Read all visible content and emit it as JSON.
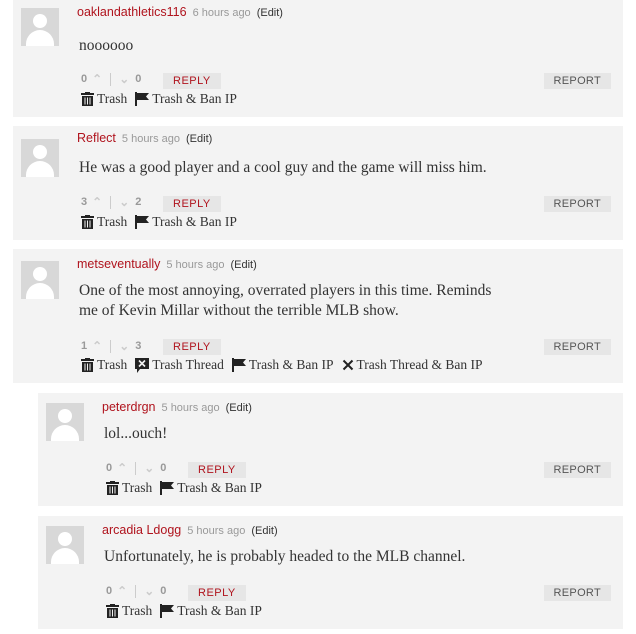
{
  "labels": {
    "edit": "(Edit)",
    "reply": "REPLY",
    "report": "REPORT",
    "trash": "Trash",
    "trash_thread": "Trash Thread",
    "trash_ban_ip": "Trash & Ban IP",
    "trash_thread_ban_ip": "Trash Thread & Ban IP"
  },
  "comments": [
    {
      "author": "oaklandathletics116",
      "time": "6 hours ago",
      "text": "noooooo",
      "up": "0",
      "down": "0"
    },
    {
      "author": "Reflect",
      "time": "5 hours ago",
      "text": "He was a good player and a cool guy and the game will miss him.",
      "up": "3",
      "down": "2"
    },
    {
      "author": "metseventually",
      "time": "5 hours ago",
      "text_line1": "One of the most annoying, overrated players in this time. Reminds",
      "text_line2": "me of Kevin Millar without the terrible MLB show.",
      "up": "1",
      "down": "3"
    },
    {
      "author": "peterdrgn",
      "time": "5 hours ago",
      "text": "lol...ouch!",
      "up": "0",
      "down": "0"
    },
    {
      "author": "arcadia Ldogg",
      "time": "5 hours ago",
      "text": "Unfortunately, he is probably headed to the MLB channel.",
      "up": "0",
      "down": "0"
    }
  ]
}
